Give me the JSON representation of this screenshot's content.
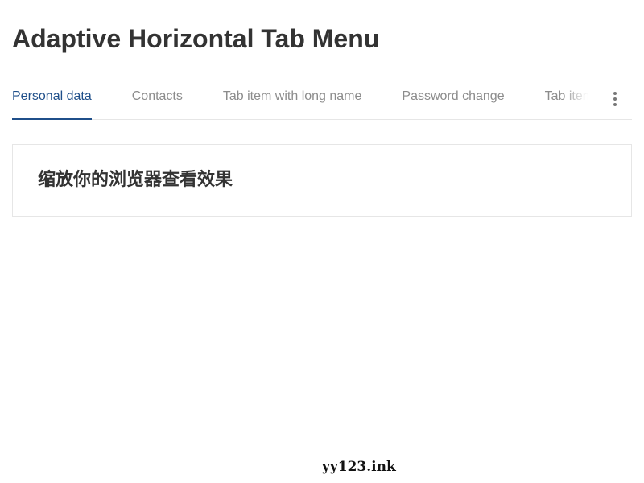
{
  "page": {
    "title": "Adaptive Horizontal Tab Menu"
  },
  "tabs": {
    "items": [
      {
        "label": "Personal data",
        "active": true
      },
      {
        "label": "Contacts",
        "active": false
      },
      {
        "label": "Tab item with long name",
        "active": false
      },
      {
        "label": "Password change",
        "active": false
      },
      {
        "label": "Tab item",
        "active": false
      }
    ],
    "more_icon": "more-vertical-icon"
  },
  "content": {
    "text": "缩放你的浏览器查看效果"
  },
  "watermark": {
    "text": "yy123.ink"
  },
  "colors": {
    "accent": "#1f4f8a",
    "tab_inactive": "#8c8c8c",
    "title": "#333333",
    "border": "#e6e6e6"
  }
}
